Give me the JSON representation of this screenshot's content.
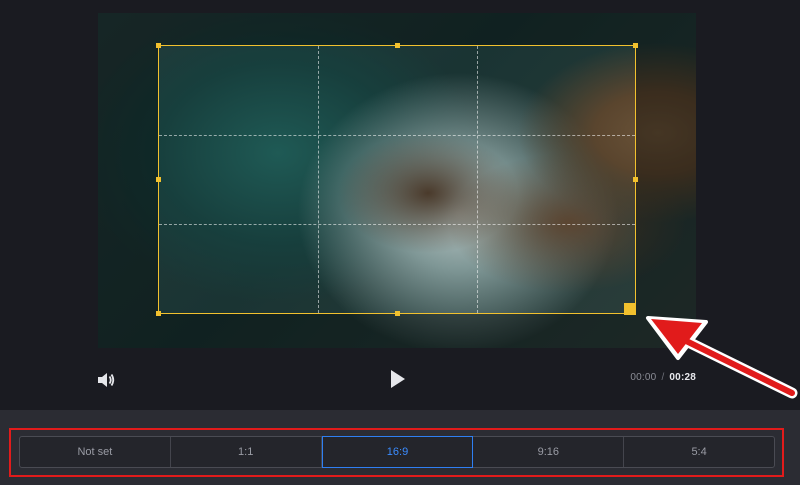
{
  "controls": {
    "current_time": "00:00",
    "separator": "/",
    "duration": "00:28",
    "volume_icon": "speaker-icon",
    "play_icon": "play-icon"
  },
  "aspect_ratios": {
    "options": [
      "Not set",
      "1:1",
      "16:9",
      "9:16",
      "5:4"
    ],
    "selected": "16:9"
  },
  "colors": {
    "crop_border": "#f2c12e",
    "selected_ratio": "#3b8cff",
    "annotation": "#e11b1b"
  }
}
